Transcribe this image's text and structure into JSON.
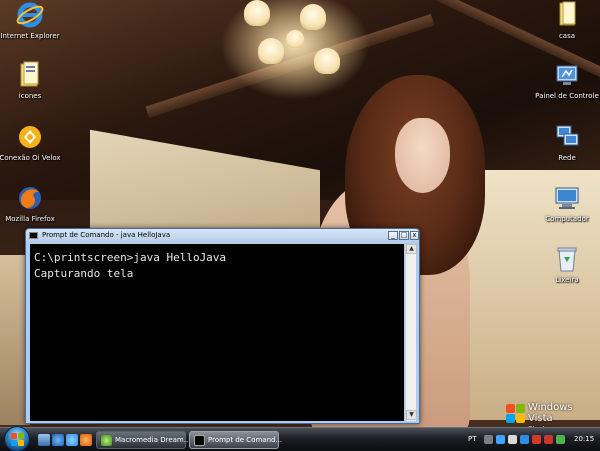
{
  "desktop": {
    "icons_left": [
      {
        "id": "internet-explorer",
        "label": "Internet Explorer",
        "icon": "internet-explorer-icon"
      },
      {
        "id": "icones",
        "label": "icones",
        "icon": "folder-icon"
      },
      {
        "id": "conexao-oi-velox",
        "label": "Conexão Oi Velox",
        "icon": "connection-icon"
      },
      {
        "id": "mozilla-firefox",
        "label": "Mozilla Firefox",
        "icon": "firefox-icon"
      }
    ],
    "icons_right": [
      {
        "id": "casa",
        "label": "casa",
        "icon": "folder-icon"
      },
      {
        "id": "painel-de-controle",
        "label": "Painel de Controle",
        "icon": "control-panel-icon"
      },
      {
        "id": "rede",
        "label": "Rede",
        "icon": "network-icon"
      },
      {
        "id": "computador",
        "label": "Computador",
        "icon": "computer-icon"
      },
      {
        "id": "lixeira",
        "label": "Lixeira",
        "icon": "recycle-bin-icon"
      }
    ],
    "branding": {
      "line1": "Windows Vista",
      "line2": "Starter"
    }
  },
  "console": {
    "title": "Prompt de Comando - java  HelloJava",
    "buttons": {
      "minimize": "_",
      "maximize": "□",
      "close": "x"
    },
    "lines": [
      "C:\\printscreen>java HelloJava",
      "Capturando tela"
    ],
    "scroll_up": "▲",
    "scroll_down": "▼"
  },
  "taskbar": {
    "tasks": [
      {
        "label": "Macromedia Dream...",
        "icon": "dreamweaver-icon",
        "active": false
      },
      {
        "label": "Prompt de Comand...",
        "icon": "command-prompt-icon",
        "active": true
      }
    ],
    "language": "PT",
    "clock": "20:15"
  },
  "colors": {
    "console_bg": "#000000",
    "console_text": "#e8e8e8",
    "window_frame": "#aeccef",
    "taskbar": "#1c1f24"
  }
}
